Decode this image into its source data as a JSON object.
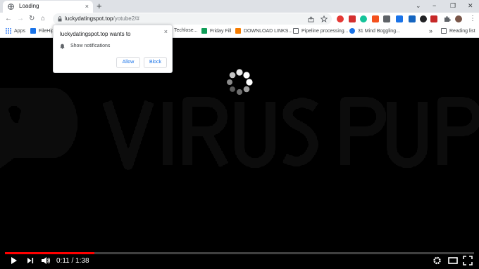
{
  "tab": {
    "title": "Loading",
    "close": "×"
  },
  "window": {
    "new_tab": "+",
    "minimize": "−",
    "maximize": "❐",
    "close": "✕",
    "tab_search": "⌄"
  },
  "toolbar": {
    "back": "←",
    "forward": "→",
    "reload": "↻",
    "home": "⌂",
    "menu": "⋮"
  },
  "omnibox": {
    "host": "luckydatingspot.top",
    "path": "/yotube2/#",
    "share_icon": "share-icon",
    "star_icon": "star-icon"
  },
  "bookmarks": {
    "items": [
      {
        "label": "Apps",
        "color": "#4285f4"
      },
      {
        "label": "FileHip",
        "color": "#1a73e8"
      },
      {
        "label": "Techlose...",
        "color": "#5f6368"
      },
      {
        "label": "Friday Fill",
        "color": "#0f9d58"
      },
      {
        "label": "DOWNLOAD LINKS...",
        "color": "#f57c00"
      },
      {
        "label": "Pipeline processing...",
        "color": "#e8eaed"
      },
      {
        "label": "31 Mind Boggling...",
        "color": "#1a73e8"
      }
    ],
    "more": "»",
    "reading_list": "Reading list"
  },
  "notification": {
    "title": "luckydatingspot.top wants to",
    "message": "Show notifications",
    "allow": "Allow",
    "block": "Block",
    "close": "×"
  },
  "player": {
    "time": "0:11 / 1:38",
    "progress": 0.19,
    "accent": "#ff0000"
  },
  "colors": {
    "toolbar": "#ffffff",
    "tabstrip": "#dee1e6",
    "link": "#1a73e8"
  }
}
